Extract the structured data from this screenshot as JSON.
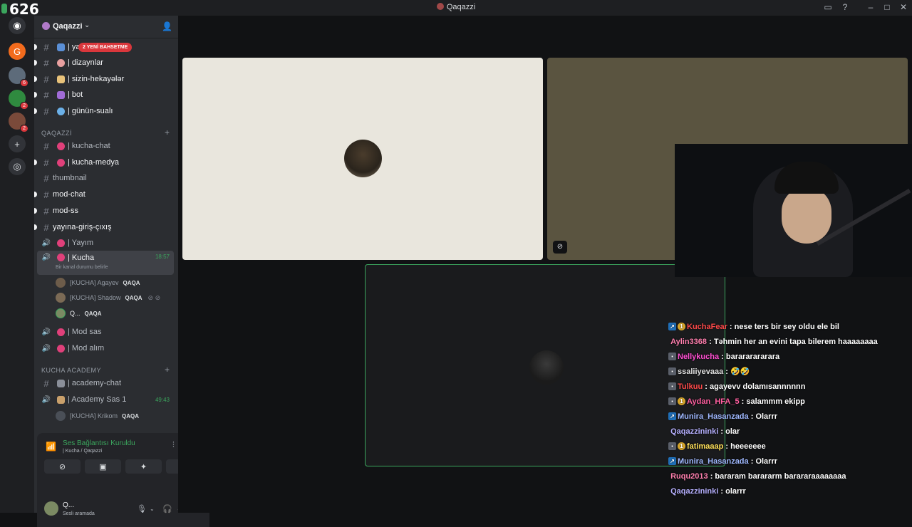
{
  "titlebar": {
    "counter": "626",
    "window_title": "Qaqazzi"
  },
  "servers": [
    {
      "icon": "discord-icon",
      "badge": ""
    },
    {
      "icon": "server-g",
      "badge": ""
    },
    {
      "icon": "server-a",
      "badge": "6"
    },
    {
      "icon": "server-b",
      "badge": "2"
    },
    {
      "icon": "server-c",
      "badge": "2"
    }
  ],
  "guild": {
    "name": "Qaqazzi"
  },
  "mention_badge": "2 YENİ BAHSETME",
  "channels_top": [
    {
      "label": "| ya"
    },
    {
      "label": "| dizaynlar"
    },
    {
      "label": "| sizin-hekayələr"
    },
    {
      "label": "| bot"
    },
    {
      "label": "| günün-sualı"
    }
  ],
  "category1": "QAQAZZİ",
  "channels_mid": [
    {
      "label": "| kucha-chat"
    },
    {
      "label": "| kucha-medya"
    },
    {
      "label": "thumbnail"
    },
    {
      "label": "mod-chat"
    },
    {
      "label": "mod-ss"
    },
    {
      "label": "yayına-giriş-çıxış"
    }
  ],
  "voice_channels": [
    {
      "label": "| Yayım"
    },
    {
      "label": "| Kucha",
      "time": "18:57",
      "status": "Bir kanal durumu belirle"
    }
  ],
  "voice_users": [
    {
      "name": "[KUCHA] Agayev",
      "tag": "QAQA"
    },
    {
      "name": "[KUCHA] Shadow",
      "tag": "QAQA"
    },
    {
      "name": "Q...",
      "tag": "QAQA"
    }
  ],
  "voice_channels2": [
    {
      "label": "| Mod sas"
    },
    {
      "label": "| Mod alım"
    }
  ],
  "category2": "KUCHA ACADEMY",
  "academy": [
    {
      "label": "| academy-chat"
    },
    {
      "label": "| Academy Sas 1",
      "time": "49:43"
    }
  ],
  "academy_user": {
    "name": "[KUCHA] Krikom",
    "tag": "QAQA"
  },
  "voice_panel": {
    "title": "Ses Bağlantısı Kuruldu",
    "sub": "| Kucha / Qaqazzi"
  },
  "user_panel": {
    "name": "Q...",
    "status": "Sesli aramada"
  },
  "chat": [
    {
      "user": "KuchaFear",
      "color": "#ff4a4a",
      "text": ": nese ters bir sey oldu ele bil",
      "badges": 2
    },
    {
      "user": "Aylin3368",
      "color": "#ff7fae",
      "text": ": Təhmin her an evini tapa bilerem haaaaaaaa",
      "badges": 0
    },
    {
      "user": "Nellykucha",
      "color": "#ff4fd2",
      "text": ": barararararara",
      "badges": 1
    },
    {
      "user": "ssaliiyevaaa",
      "color": "#e0e0e0",
      "text": ": 🤣🤣",
      "badges": 1
    },
    {
      "user": "Tulkuu",
      "color": "#ff4a4a",
      "text": ": agayevv dolamısannnnnn",
      "badges": 1
    },
    {
      "user": "Aydan_HFA_5",
      "color": "#ff5fa0",
      "text": ": salammm ekipp",
      "badges": 2
    },
    {
      "user": "Munira_Hasanzada",
      "color": "#9fb8ff",
      "text": ": Olarrr",
      "badges": 1
    },
    {
      "user": "Qaqazzininki",
      "color": "#b6b0ff",
      "text": ": olar",
      "badges": 0
    },
    {
      "user": "fatimaaap",
      "color": "#ffe15a",
      "text": ": heeeeeee",
      "badges": 1
    },
    {
      "user": "Munira_Hasanzada",
      "color": "#9fb8ff",
      "text": ": Olarrr",
      "badges": 1
    },
    {
      "user": "Ruqu2013",
      "color": "#ff7fae",
      "text": ": bararam barararm barararaaaaaaaa",
      "badges": 0
    },
    {
      "user": "Qaqazzininki",
      "color": "#b6b0ff",
      "text": ": olarrr",
      "badges": 0
    }
  ]
}
